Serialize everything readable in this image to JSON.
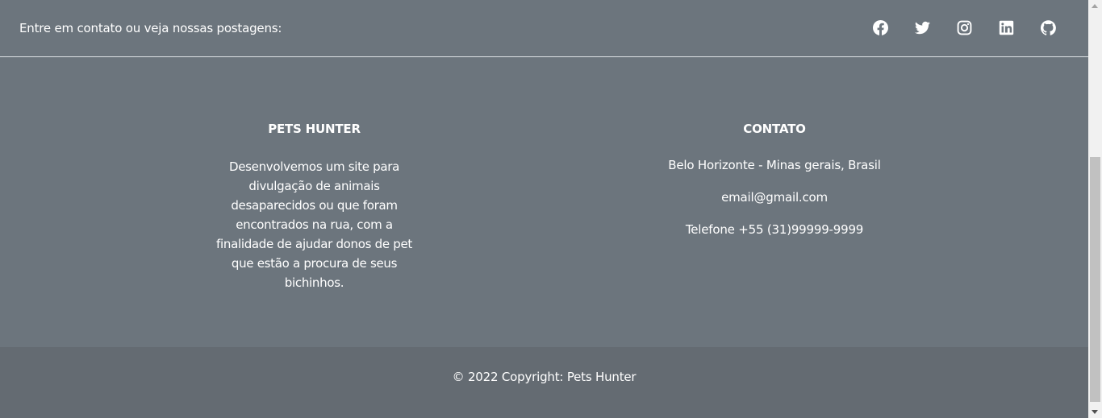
{
  "social": {
    "prompt": "Entre em contato ou veja nossas postagens:",
    "icons": [
      "facebook-icon",
      "twitter-icon",
      "instagram-icon",
      "linkedin-icon",
      "github-icon"
    ]
  },
  "about": {
    "title": "PETS HUNTER",
    "text": "Desenvolvemos um site para divulgação de animais desaparecidos ou que foram encontrados na rua, com a finalidade de ajudar donos de pet que estão a procura de seus bichinhos."
  },
  "contact": {
    "title": "CONTATO",
    "address": "Belo Horizonte - Minas gerais, Brasil",
    "email": "email@gmail.com",
    "phone": "Telefone +55 (31)99999-9999"
  },
  "copyright": {
    "text": "© 2022 Copyright: Pets Hunter"
  },
  "colors": {
    "footer_bg": "#6c757d",
    "copyright_bg": "#646b72",
    "text": "#ffffff"
  }
}
